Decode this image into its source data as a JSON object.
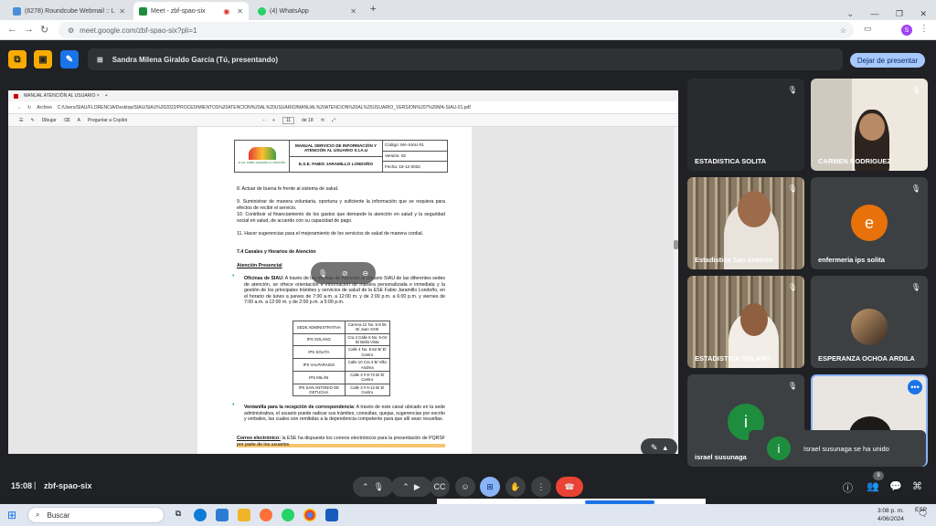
{
  "browser": {
    "tabs": [
      {
        "title": "(6278) Roundcube Webmail :: L",
        "color": "#4a90d9"
      },
      {
        "title": "Meet - zbf-spao-six",
        "color": "#1e8e3e"
      },
      {
        "title": "(4) WhatsApp",
        "color": "#25d366"
      }
    ],
    "new_tab": "+",
    "url": "meet.google.com/zbf-spao-six?pli=1",
    "profile_initial": "S"
  },
  "meet": {
    "presenter_label": "Sandra Milena Giraldo García (Tú, presentando)",
    "stop_presenting": "Dejar de presentar",
    "clock": "15:08",
    "meeting_code": "zbf-spao-six",
    "participant_count": "9",
    "toast": "Israel susunaga se ha unido"
  },
  "pdf_viewer": {
    "tab_title": "MANUAL ATENCIÓN AL USUARIO ×",
    "file_label": "Archivo",
    "path": "C:/Users/SIAU/FLORENCIA/Desktop/SIAU/SIAU%202022/PROCEDIMIENTOS%20ATENCION%20AL%20USUARIO/MANUAL%20ATENCION%20AL%20USUARIO_VERSION%207%20MA-SIAU-01.pdf",
    "draw_label": "Dibujar",
    "copilot_label": "Preguntar a Copilot",
    "page_current": "11",
    "page_total": "de 18"
  },
  "document": {
    "header": {
      "logo_text": "E.S.E. FABIO JARAMILLO LONDOÑO",
      "title": "MANUAL SERVICIO DE INFORMACIÓN Y ATENCIÓN AL USUARIO S.I.A.U",
      "entity": "E.S.E. FABIO JARAMILLO LONDOÑO",
      "code": "Código: MA-SIAU-01",
      "version": "Versión: 02",
      "date": "Fecha: 15-12-2022"
    },
    "p8": "8. Actuar de buena fe frente al sistema de salud.",
    "p9": "9. Suministrar de manera voluntaria, oportuna y suficiente la información que se requiera para efectos de recibir el servicio.",
    "p10": "10. Contribuir al financiamiento de los gastos que demande la atención en salud y la seguridad social en salud, de acuerdo con su capacidad de pago.",
    "p11": "11. Hacer sugerencias para el mejoramiento de los servicios de salud de manera cordial.",
    "section": "7.4 Canales y Horarios de Atención",
    "subsection": "Atención Presencial",
    "oficinas_title": "Oficinas de SIAU:",
    "oficinas_text": " A través de las oficinas de Atención al Usuario SIAU de las diferentes sedes de atención, se ofrece orientación e información de manera personalizada e inmediata y la gestión de los principales trámites y servicios de salud de la ESE Fabio Jaramillo Londoño, en el horario de lunes a jueves de 7:00 a.m. a 12:00 m. y de 2:00 p.m. a 6:00 p.m. y viernes de 7:00 a.m. a 12:00 m. y de 2:00 p.m. a 5:00 p.m.",
    "table": [
      [
        "SEDE ADMINISTRATIVA",
        "Carrera 12 No. 5-8 06 B/ Juan XXIII"
      ],
      [
        "IPS SOLANO",
        "Cra 4 Calle 6 No. 6-04 B/ Bella Vista"
      ],
      [
        "IPS SOLITA",
        "Calle 4 No. 5-52 B/ El Centro"
      ],
      [
        "IPS VALPARAISO",
        "Calle 10 Cra 3 B/ Villa Andrea"
      ],
      [
        "IPS MILÁN",
        "Calle 3 # 8-72 B/ El Centro"
      ],
      [
        "IPS SAN ANTONIO DE GETUCHA",
        "Calle 3 # 6-12 B/ El Centro"
      ]
    ],
    "ventanilla_title": "Ventanilla para la recepción de correspondencia",
    "ventanilla_text": ": A través de este canal ubicado en la sede administrativa, el usuario puede radicar sus trámites, consultas, quejas, sugerencias por escrito y verbales, las cuales son remitidas a la dependencia competente para que allí sean resueltas.",
    "correo_title": "Correo electrónico:",
    "correo_text": " la ESE ha dispuesto los correos electrónicos para la presentación de PQRSF por parte de los usuarios."
  },
  "participants": [
    {
      "name": "ESTADISTICA SOLITA"
    },
    {
      "name": "CARMEN RODRIGUEZ"
    },
    {
      "name": "Estadistica San Antonio"
    },
    {
      "name": "enfermeria ips solita",
      "initial": "e",
      "avatar_color": "#e8710a"
    },
    {
      "name": "ESTADISTICA SOLANO"
    },
    {
      "name": "ESPERANZA OCHOA ARDILA"
    },
    {
      "name": "israel susunaga",
      "initial": "i",
      "avatar_color": "#1e8e3e"
    },
    {
      "name": ""
    }
  ],
  "taskbar": {
    "search_placeholder": "Buscar",
    "time": "3:08 p. m.",
    "date": "4/06/2024",
    "lang": "ESP"
  }
}
